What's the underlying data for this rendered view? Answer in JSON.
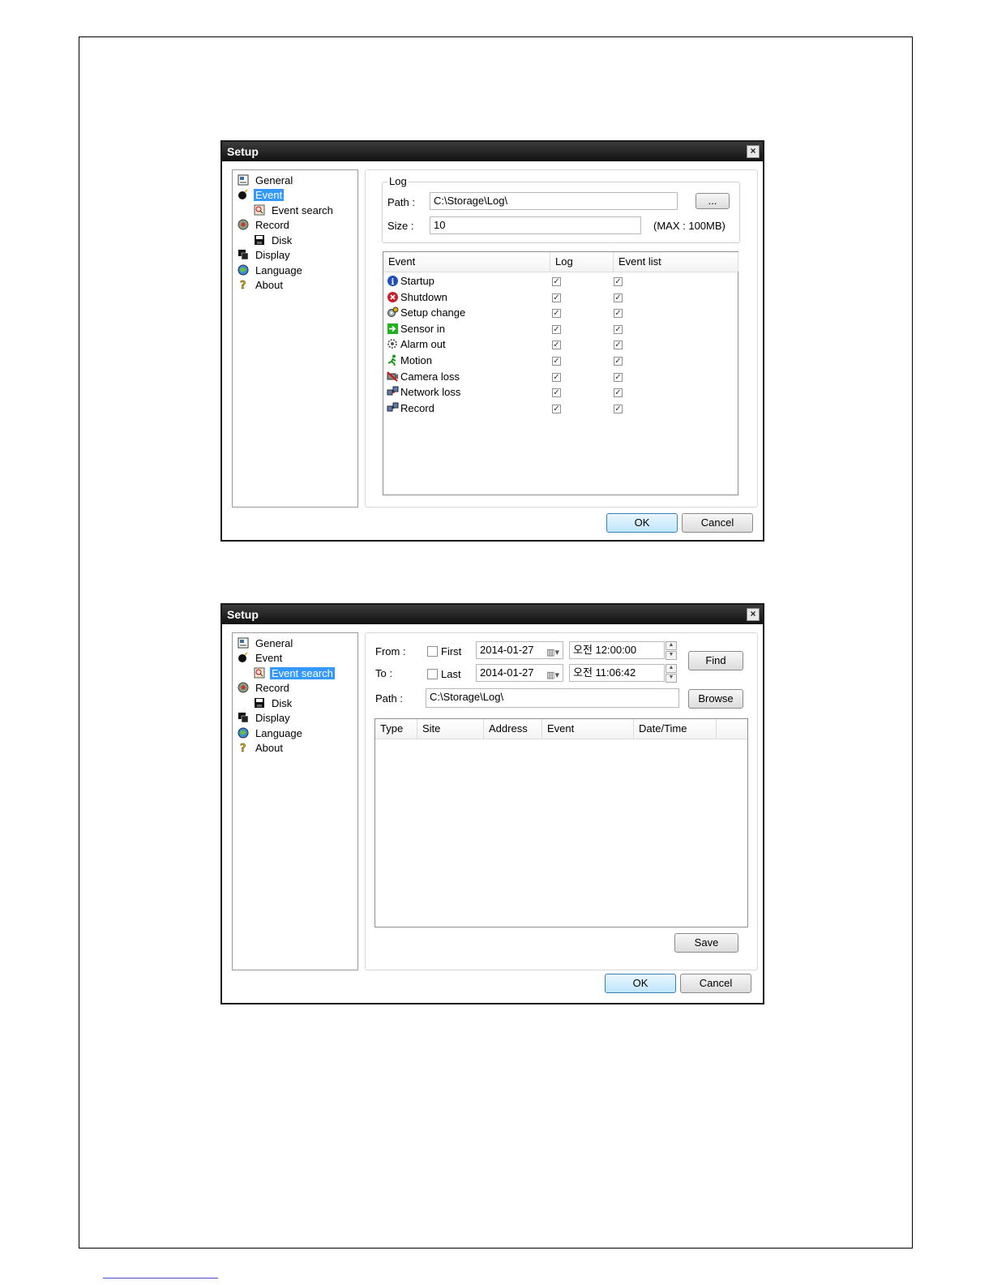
{
  "dialog1": {
    "title": "Setup",
    "close": "×",
    "tree": [
      {
        "label": "General",
        "icon": "general-icon"
      },
      {
        "label": "Event",
        "icon": "bomb-icon",
        "selected": true
      },
      {
        "label": "Event search",
        "icon": "event-search-icon",
        "child": true
      },
      {
        "label": "Record",
        "icon": "record-icon"
      },
      {
        "label": "Disk",
        "icon": "disk-icon",
        "child": true
      },
      {
        "label": "Display",
        "icon": "display-icon"
      },
      {
        "label": "Language",
        "icon": "globe-icon"
      },
      {
        "label": "About",
        "icon": "question-icon"
      }
    ],
    "log": {
      "group_title": "Log",
      "path_label": "Path :",
      "path_value": "C:\\Storage\\Log\\",
      "browse": "...",
      "size_label": "Size :",
      "size_value": "10",
      "max_note": "(MAX : 100MB)"
    },
    "columns": {
      "event": "Event",
      "log": "Log",
      "event_list": "Event list"
    },
    "events": [
      {
        "name": "Startup",
        "icon": "info-icon",
        "log": true,
        "list": true
      },
      {
        "name": "Shutdown",
        "icon": "shutdown-icon",
        "log": true,
        "list": true
      },
      {
        "name": "Setup change",
        "icon": "gear-icon",
        "log": true,
        "list": true
      },
      {
        "name": "Sensor in",
        "icon": "sensor-icon",
        "log": true,
        "list": true
      },
      {
        "name": "Alarm out",
        "icon": "alarm-icon",
        "log": true,
        "list": true
      },
      {
        "name": "Motion",
        "icon": "motion-icon",
        "log": true,
        "list": true
      },
      {
        "name": "Camera loss",
        "icon": "camera-loss-icon",
        "log": true,
        "list": true
      },
      {
        "name": "Network loss",
        "icon": "network-loss-icon",
        "log": true,
        "list": true
      },
      {
        "name": "Record",
        "icon": "network-icon",
        "log": true,
        "list": true
      }
    ],
    "check_mark": "✓",
    "ok": "OK",
    "cancel": "Cancel"
  },
  "dialog2": {
    "title": "Setup",
    "close": "×",
    "tree": [
      {
        "label": "General",
        "icon": "general-icon"
      },
      {
        "label": "Event",
        "icon": "bomb-icon"
      },
      {
        "label": "Event search",
        "icon": "event-search-icon",
        "child": true,
        "selected": true
      },
      {
        "label": "Record",
        "icon": "record-icon"
      },
      {
        "label": "Disk",
        "icon": "disk-icon",
        "child": true
      },
      {
        "label": "Display",
        "icon": "display-icon"
      },
      {
        "label": "Language",
        "icon": "globe-icon"
      },
      {
        "label": "About",
        "icon": "question-icon"
      }
    ],
    "from_label": "From :",
    "to_label": "To :",
    "first_label": "First",
    "last_label": "Last",
    "from_date": "2014-01-27",
    "to_date": "2014-01-27",
    "from_time": "오전 12:00:00",
    "to_time": "오전 11:06:42",
    "find": "Find",
    "path_label": "Path :",
    "path_value": "C:\\Storage\\Log\\",
    "browse": "Browse",
    "columns": [
      "Type",
      "Site",
      "Address",
      "Event",
      "Date/Time"
    ],
    "save": "Save",
    "ok": "OK",
    "cancel": "Cancel"
  },
  "colors": {
    "selection": "#3399ff",
    "ok_border": "#3c7fb1"
  }
}
